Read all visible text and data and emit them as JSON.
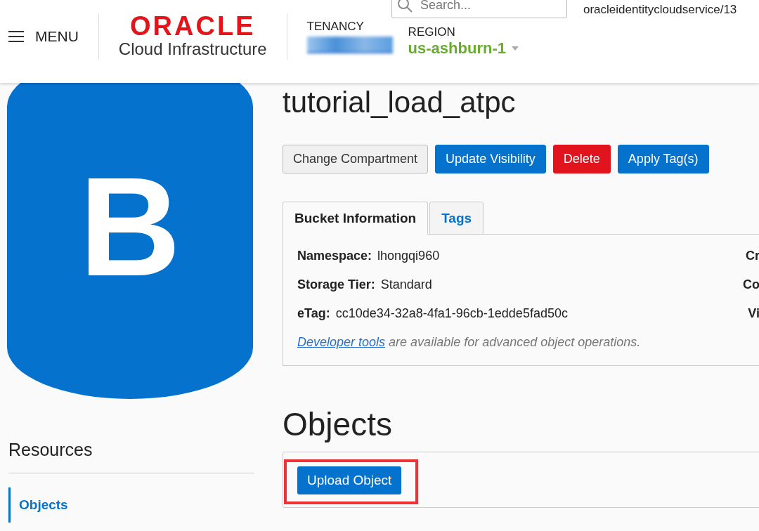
{
  "header": {
    "menu_label": "MENU",
    "logo": {
      "brand": "ORACLE",
      "product": "Cloud Infrastructure"
    },
    "tenancy_label": "TENANCY",
    "region_label": "REGION",
    "region": "us-ashburn-1",
    "search": {
      "placeholder": "Search..."
    },
    "user": "oracleidentitycloudservice/13"
  },
  "bucket_icon": {
    "letter": "B"
  },
  "title": "tutorial_load_atpc",
  "actions": [
    {
      "label": "Change Compartment",
      "kind": "default"
    },
    {
      "label": "Update Visibility",
      "kind": "primary"
    },
    {
      "label": "Delete",
      "kind": "danger"
    },
    {
      "label": "Apply Tag(s)",
      "kind": "primary"
    }
  ],
  "tabs": [
    {
      "label": "Bucket Information",
      "selected": true
    },
    {
      "label": "Tags",
      "selected": false
    }
  ],
  "info": [
    {
      "label": "Namespace:",
      "value": "lhongqi960",
      "column_2": "Cr"
    },
    {
      "label": "Storage Tier:",
      "value": "Standard",
      "column_2": "Co"
    },
    {
      "label": "eTag:",
      "value": "cc10de34-32a8-4fa1-96cb-1edde5fad50c",
      "column_2": "Vi"
    }
  ],
  "note": {
    "link": "Developer tools",
    "text": "are available for advanced object operations."
  },
  "resources": {
    "title": "Resources",
    "items": [
      {
        "label": "Objects",
        "selected": true
      }
    ]
  },
  "objects": {
    "title": "Objects",
    "upload_button": "Upload Object",
    "highlighted": true
  }
}
